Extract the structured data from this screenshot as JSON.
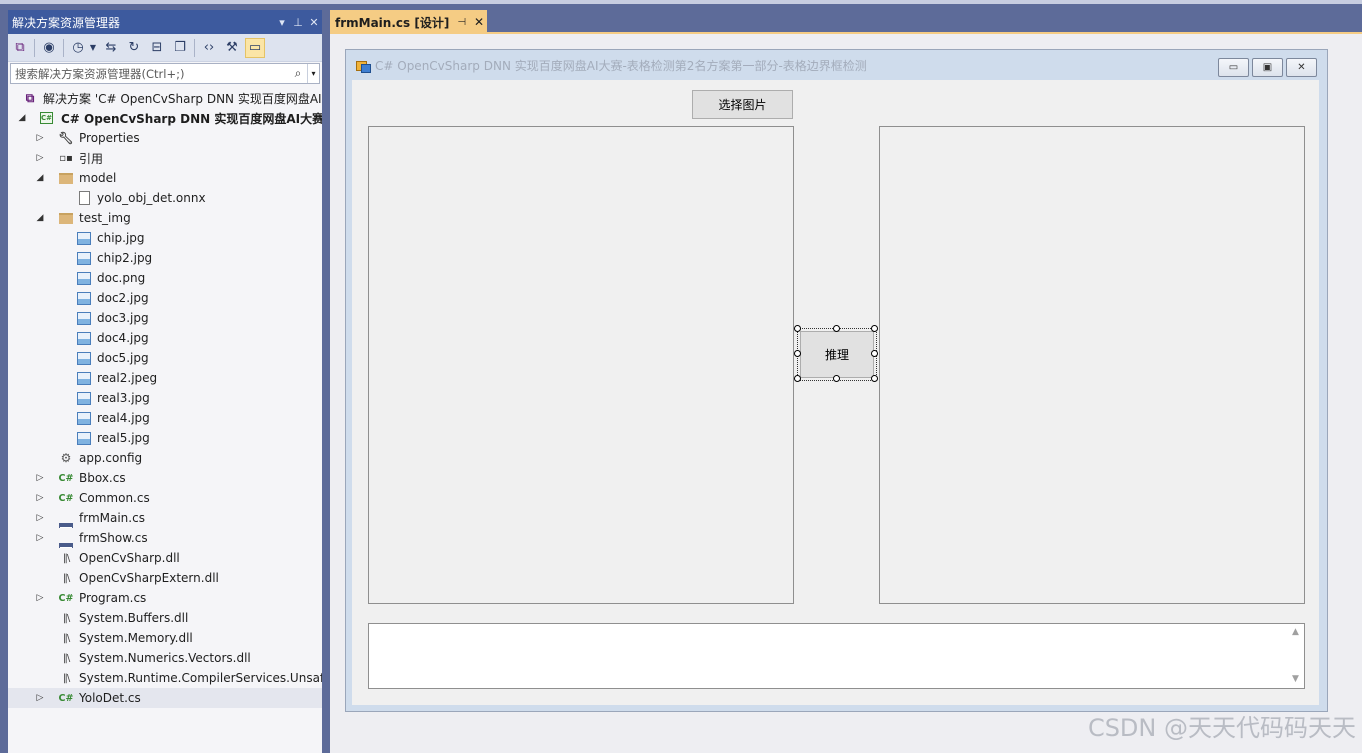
{
  "solution_explorer": {
    "title": "解决方案资源管理器",
    "title_controls": [
      "▾",
      "⊥",
      "✕"
    ],
    "search_placeholder": "搜索解决方案资源管理器(Ctrl+;)",
    "solution_label": "解决方案 'C# OpenCvSharp DNN 实现百度网盘AI大赛-表格检测第2名方案第一部分-表格边界框检测'",
    "project_label": "C# OpenCvSharp DNN 实现百度网盘AI大赛-表格检测第2名方案第一部分-表格边界框检测",
    "items": [
      {
        "label": "Properties"
      },
      {
        "label": "引用"
      },
      {
        "label": "model"
      },
      {
        "label": "yolo_obj_det.onnx"
      },
      {
        "label": "test_img"
      },
      {
        "label": "chip.jpg"
      },
      {
        "label": "chip2.jpg"
      },
      {
        "label": "doc.png"
      },
      {
        "label": "doc2.jpg"
      },
      {
        "label": "doc3.jpg"
      },
      {
        "label": "doc4.jpg"
      },
      {
        "label": "doc5.jpg"
      },
      {
        "label": "real2.jpeg"
      },
      {
        "label": "real3.jpg"
      },
      {
        "label": "real4.jpg"
      },
      {
        "label": "real5.jpg"
      },
      {
        "label": "app.config"
      },
      {
        "label": "Bbox.cs"
      },
      {
        "label": "Common.cs"
      },
      {
        "label": "frmMain.cs"
      },
      {
        "label": "frmShow.cs"
      },
      {
        "label": "OpenCvSharp.dll"
      },
      {
        "label": "OpenCvSharpExtern.dll"
      },
      {
        "label": "Program.cs"
      },
      {
        "label": "System.Buffers.dll"
      },
      {
        "label": "System.Memory.dll"
      },
      {
        "label": "System.Numerics.Vectors.dll"
      },
      {
        "label": "System.Runtime.CompilerServices.Unsafe.dll"
      },
      {
        "label": "YoloDet.cs"
      }
    ]
  },
  "editor": {
    "tab_label": "frmMain.cs [设计]",
    "tab_pin": "⊣",
    "tab_close": "✕"
  },
  "form": {
    "title": "C# OpenCvSharp DNN 实现百度网盘AI大赛-表格检测第2名方案第一部分-表格边界框检测",
    "select_button": "选择图片",
    "infer_button": "推理",
    "minimize": "▭",
    "maximize": "▣",
    "close": "✕"
  },
  "watermark": "CSDN @天天代码码天天"
}
